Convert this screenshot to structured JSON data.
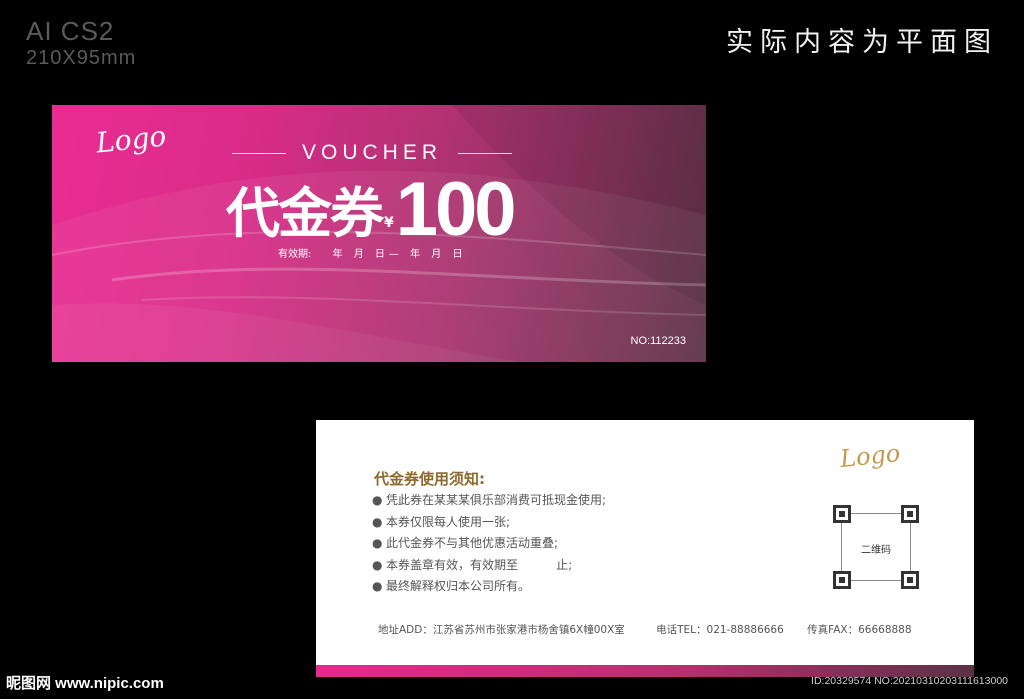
{
  "meta": {
    "app_version": "AI CS2",
    "size": "210X95mm",
    "flat_note": "实际内容为平面图"
  },
  "front": {
    "logo": "Logo",
    "voucher_word": "VOUCHER",
    "title_cn": "代金券",
    "currency": "¥",
    "amount": "100",
    "validity_label": "有效期:",
    "validity_dates": "年 月 日— 年 月 日",
    "serial": "NO:112233",
    "colors": {
      "start": "#ea2c93",
      "end": "#5c3146"
    }
  },
  "back": {
    "logo": "Logo",
    "notice_title": "代金券使用须知:",
    "rules": [
      "凭此券在某某某俱乐部消费可抵现金使用;",
      "本券仅限每人使用一张;",
      "此代金券不与其他优惠活动重叠;",
      "本券盖章有效，有效期至          止;",
      "最终解释权归本公司所有。"
    ],
    "qr_label": "二维码",
    "address": "地址ADD：江苏省苏州市张家港市杨舍镇6X幢00X室",
    "tel": "电话TEL：021-88886666",
    "fax": "传真FAX：66668888"
  },
  "watermark": {
    "site": "昵图网 www.nipic.com",
    "id": "ID:20329574 NO:20210310203111613000"
  }
}
